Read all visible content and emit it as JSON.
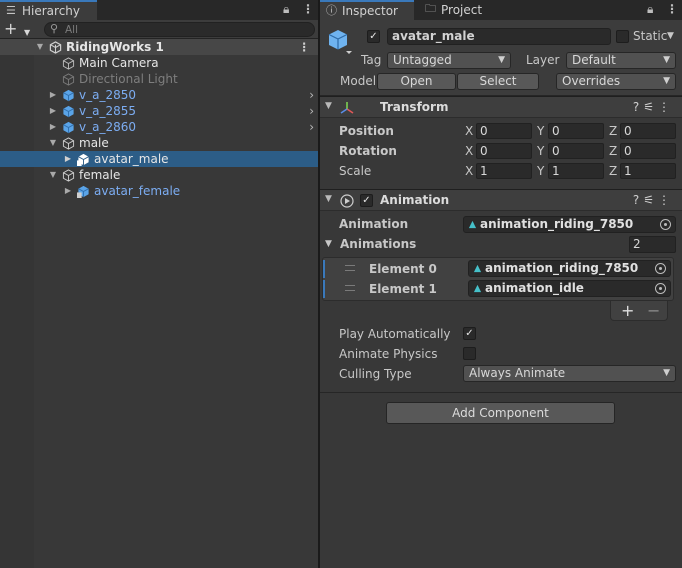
{
  "hierarchy": {
    "tab_label": "Hierarchy",
    "search_placeholder": "All",
    "scene_name": "RidingWorks 1",
    "items": [
      {
        "label": "Main Camera"
      },
      {
        "label": "Directional Light"
      },
      {
        "label": "v_a_2850"
      },
      {
        "label": "v_a_2855"
      },
      {
        "label": "v_a_2860"
      },
      {
        "label": "male"
      },
      {
        "label": "avatar_male"
      },
      {
        "label": "female"
      },
      {
        "label": "avatar_female"
      }
    ]
  },
  "inspector": {
    "tabs": [
      {
        "label": "Inspector"
      },
      {
        "label": "Project"
      }
    ],
    "object_name": "avatar_male",
    "static_label": "Static",
    "tag_label": "Tag",
    "tag_value": "Untagged",
    "layer_label": "Layer",
    "layer_value": "Default",
    "model_label": "Model",
    "open_label": "Open",
    "select_label": "Select",
    "overrides_label": "Overrides",
    "transform": {
      "title": "Transform",
      "position_label": "Position",
      "rotation_label": "Rotation",
      "scale_label": "Scale",
      "axis_x": "X",
      "axis_y": "Y",
      "axis_z": "Z",
      "position": {
        "x": "0",
        "y": "0",
        "z": "0"
      },
      "rotation": {
        "x": "0",
        "y": "0",
        "z": "0"
      },
      "scale": {
        "x": "1",
        "y": "1",
        "z": "1"
      }
    },
    "animation": {
      "title": "Animation",
      "animation_label": "Animation",
      "animation_value": "animation_riding_7850",
      "animations_label": "Animations",
      "animations_count": "2",
      "elements": [
        {
          "label": "Element 0",
          "value": "animation_riding_7850"
        },
        {
          "label": "Element 1",
          "value": "animation_idle"
        }
      ],
      "add_symbol": "+",
      "remove_symbol": "−",
      "play_auto_label": "Play Automatically",
      "play_auto_checked": true,
      "animate_physics_label": "Animate Physics",
      "animate_physics_checked": false,
      "culling_label": "Culling Type",
      "culling_value": "Always Animate"
    },
    "add_component_label": "Add Component"
  }
}
